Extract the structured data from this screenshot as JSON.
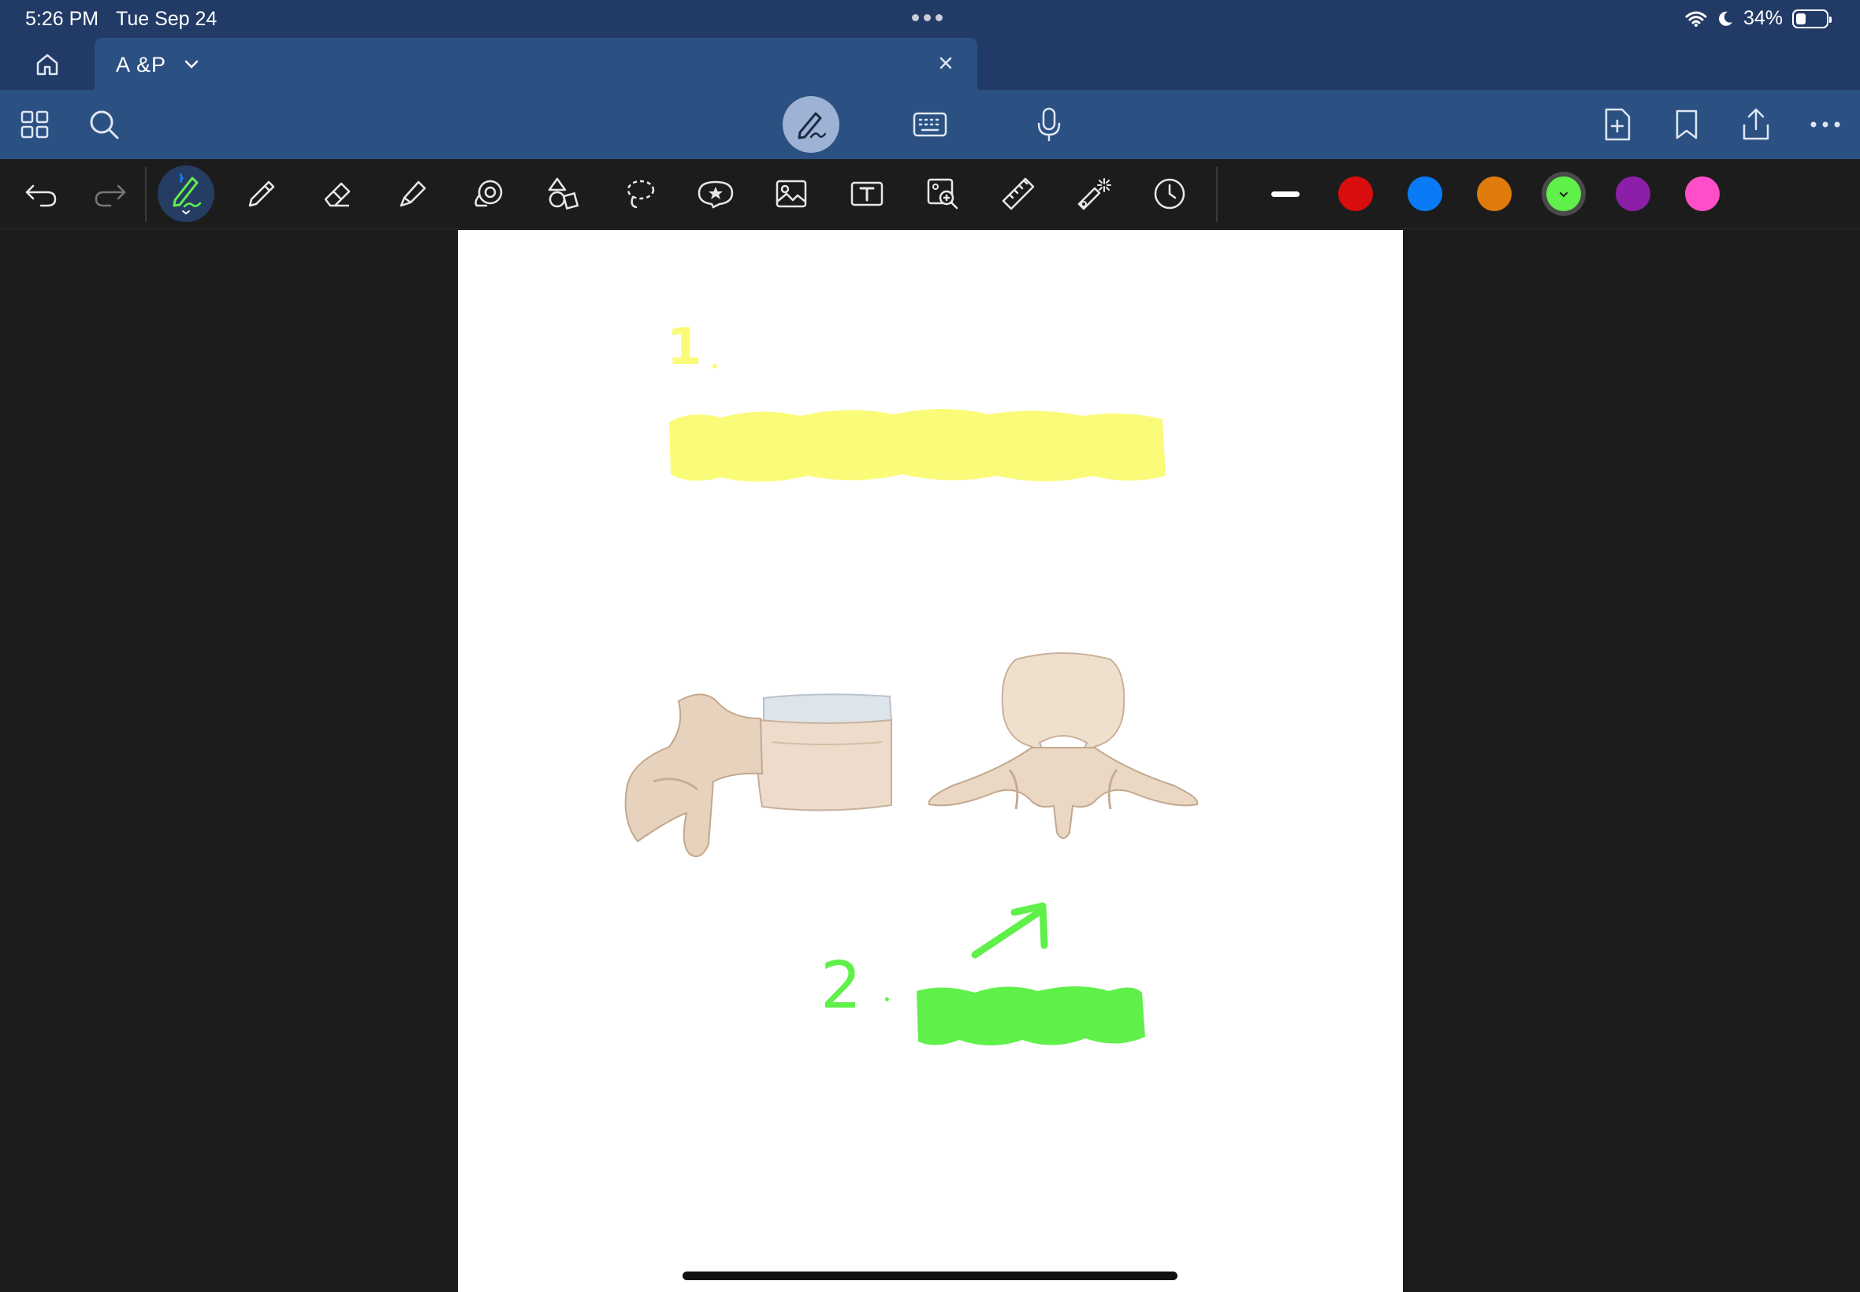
{
  "status_bar": {
    "time": "5:26 PM",
    "date": "Tue Sep 24",
    "battery": "34%",
    "battery_level": 0.34
  },
  "tab": {
    "title": "A &P"
  },
  "icons": {
    "home": "home-icon",
    "thumbnails": "grid-icon",
    "search": "search-icon",
    "pen_mode": "handwriting-pen-icon",
    "keyboard": "keyboard-icon",
    "mic": "microphone-icon",
    "add_page": "add-page-icon",
    "bookmark": "bookmark-icon",
    "share": "share-icon",
    "more": "more-icon"
  },
  "tools": [
    "undo",
    "redo",
    "pen",
    "pencil",
    "eraser",
    "highlighter",
    "shapes-lasso",
    "shapes",
    "lasso",
    "sticker",
    "image",
    "text",
    "camera-zoom",
    "ruler",
    "laser-pointer",
    "recent"
  ],
  "colors": {
    "red": "#d90d0d",
    "blue": "#0a7bf5",
    "orange": "#df7b0b",
    "green": "#5ff04a",
    "purple": "#8b1fa8",
    "pink": "#ff4fc8",
    "selected": "green"
  },
  "page": {
    "annotation_1": "1",
    "annotation_2": "2",
    "highlight_yellow": "#fbfb7a",
    "highlight_green": "#5ff04a"
  }
}
